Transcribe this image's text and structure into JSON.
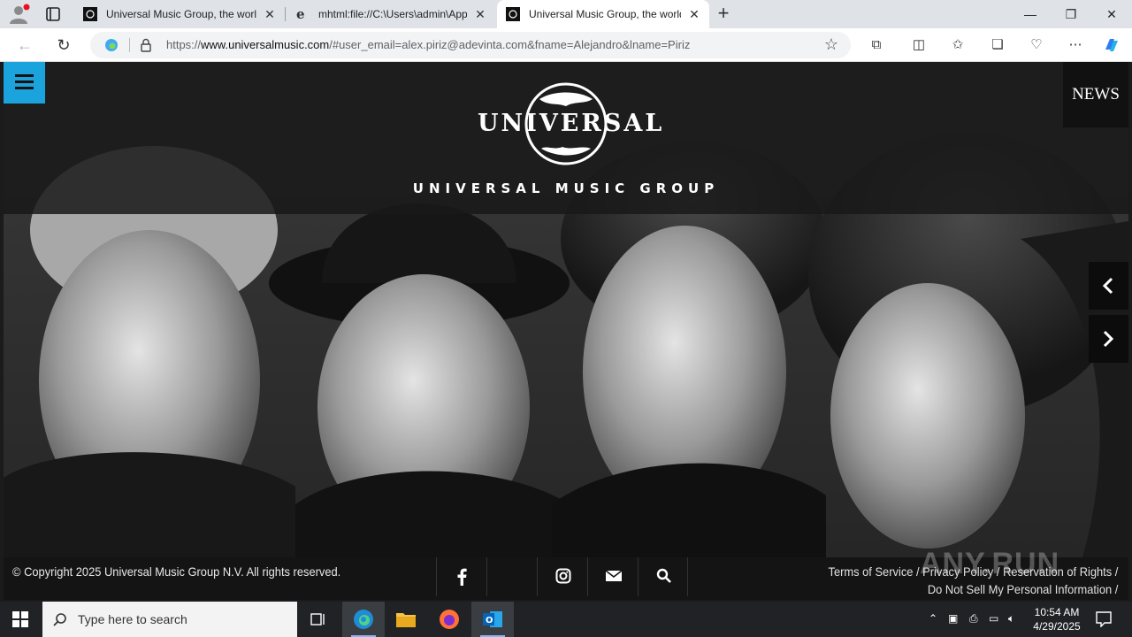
{
  "browser": {
    "tabs": [
      {
        "title": "Universal Music Group, the world's"
      },
      {
        "title": "mhtml:file://C:\\Users\\admin\\AppData"
      },
      {
        "title": "Universal Music Group, the world's"
      }
    ],
    "url_prefix": "https://",
    "url_domain": "www.universalmusic.com",
    "url_rest": "/#user_email=alex.piriz@adevinta.com&fname=Alejandro&lname=Piriz"
  },
  "page": {
    "logo_word": "UNIVERSAL",
    "group_name": "UNIVERSAL MUSIC GROUP",
    "news_label": "NEWS",
    "copyright": "© Copyright 2025 Universal Music Group N.V. All rights reserved.",
    "footer_links": [
      "Terms of Service",
      "Privacy Policy",
      "Reservation of Rights",
      "Do Not Sell My Personal Information"
    ],
    "watermark": "ANY.RUN",
    "social_icons": [
      "facebook-icon",
      "twitter-icon",
      "instagram-icon",
      "email-icon",
      "search-icon"
    ]
  },
  "taskbar": {
    "search_placeholder": "Type here to search",
    "time": "10:54 AM",
    "date": "4/29/2025"
  },
  "colors": {
    "menu_accent": "#1aa3dc",
    "page_background": "#1e1e1e"
  }
}
